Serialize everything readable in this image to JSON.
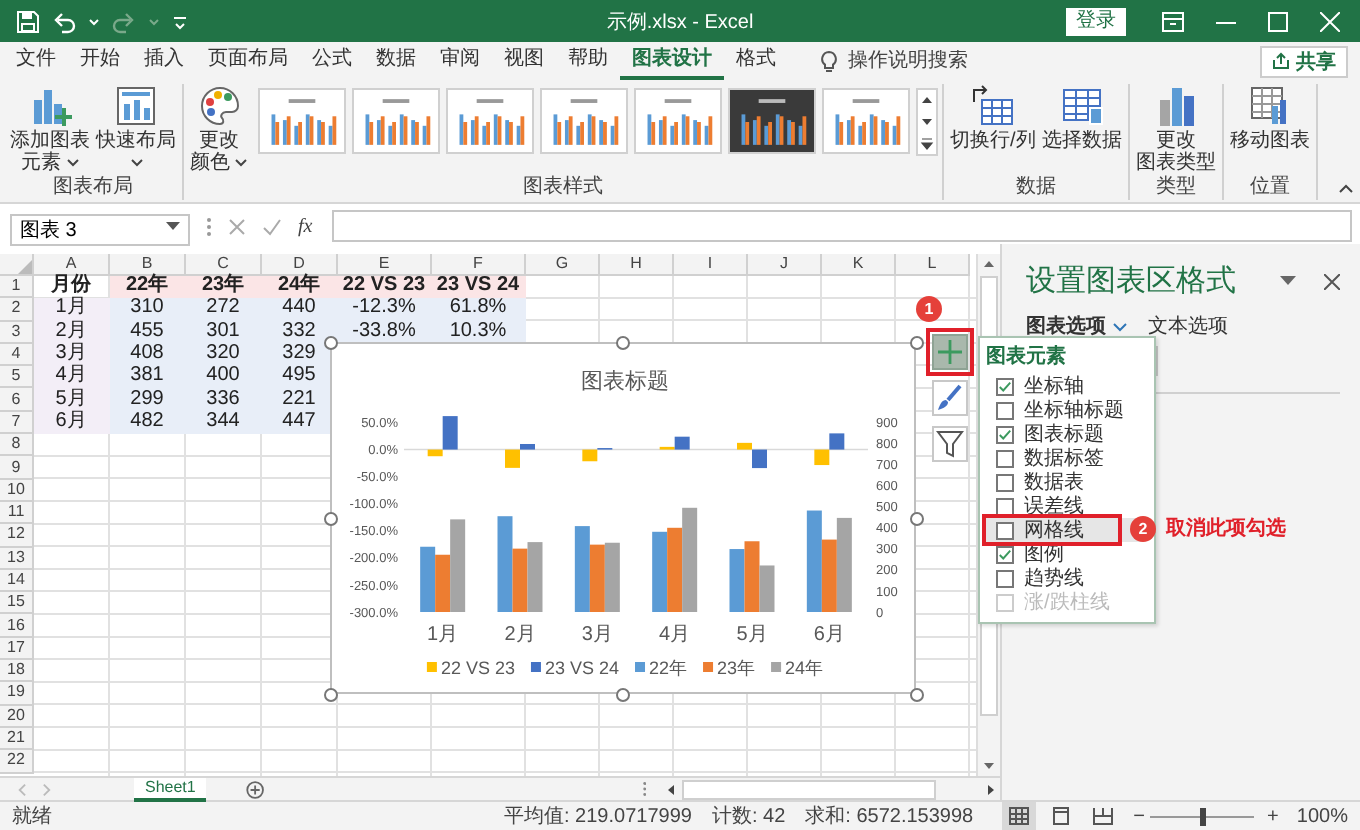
{
  "window": {
    "title": "示例.xlsx - Excel",
    "sign_in": "登录"
  },
  "tabs": [
    {
      "label": "文件",
      "selected": false
    },
    {
      "label": "开始",
      "selected": false
    },
    {
      "label": "插入",
      "selected": false
    },
    {
      "label": "页面布局",
      "selected": false
    },
    {
      "label": "公式",
      "selected": false
    },
    {
      "label": "数据",
      "selected": false
    },
    {
      "label": "审阅",
      "selected": false
    },
    {
      "label": "视图",
      "selected": false
    },
    {
      "label": "帮助",
      "selected": false
    },
    {
      "label": "图表设计",
      "selected": true
    },
    {
      "label": "格式",
      "selected": false
    }
  ],
  "search": {
    "placeholder": "操作说明搜索"
  },
  "share_button": "共享",
  "ribbon": {
    "groups": [
      {
        "label": "图表布局",
        "buttons": [
          {
            "kind": "add-element",
            "lines": [
              "添加图表",
              "元素"
            ],
            "menu": true
          },
          {
            "kind": "quick-layout",
            "lines": [
              "快速布局"
            ],
            "menu": true
          }
        ]
      },
      {
        "label": "图表样式",
        "buttons": [
          {
            "kind": "colors",
            "lines": [
              "更改",
              "颜色"
            ],
            "menu": true
          }
        ],
        "styles": [
          {
            "kind": "light"
          },
          {
            "kind": "light"
          },
          {
            "kind": "light"
          },
          {
            "kind": "light"
          },
          {
            "kind": "light"
          },
          {
            "kind": "dark"
          },
          {
            "kind": "light"
          }
        ]
      },
      {
        "label": "数据",
        "buttons": [
          {
            "kind": "switch",
            "lines": [
              "切换行/列"
            ],
            "menu": false
          },
          {
            "kind": "select-data",
            "lines": [
              "选择数据"
            ],
            "menu": false
          }
        ]
      },
      {
        "label": "类型",
        "buttons": [
          {
            "kind": "chart-type",
            "lines": [
              "更改",
              "图表类型"
            ],
            "menu": false
          }
        ]
      },
      {
        "label": "位置",
        "buttons": [
          {
            "kind": "move-chart",
            "lines": [
              "移动图表"
            ],
            "menu": false
          }
        ]
      }
    ]
  },
  "formula_bar": {
    "name_box": "图表 3",
    "function_label": "fx"
  },
  "sheet": {
    "columns": [
      "A",
      "B",
      "C",
      "D",
      "E",
      "F",
      "G",
      "H",
      "I",
      "J",
      "K",
      "L"
    ],
    "row_numbers": [
      "1",
      "2",
      "3",
      "4",
      "5",
      "6",
      "7",
      "8",
      "9",
      "10",
      "11",
      "12",
      "13",
      "14",
      "15",
      "16",
      "17",
      "18",
      "19",
      "20",
      "21",
      "22"
    ],
    "rows": [
      {
        "kind": "header",
        "cells": [
          "月份",
          "22年",
          "23年",
          "24年",
          "22 VS 23",
          "23 VS 24"
        ]
      },
      {
        "kind": "data",
        "cells": [
          "1月",
          "310",
          "272",
          "440",
          "-12.3%",
          "61.8%"
        ]
      },
      {
        "kind": "data",
        "cells": [
          "2月",
          "455",
          "301",
          "332",
          "-33.8%",
          "10.3%"
        ]
      },
      {
        "kind": "data",
        "cells": [
          "3月",
          "408",
          "320",
          "329"
        ]
      },
      {
        "kind": "data",
        "cells": [
          "4月",
          "381",
          "400",
          "495"
        ]
      },
      {
        "kind": "data",
        "cells": [
          "5月",
          "299",
          "336",
          "221"
        ]
      },
      {
        "kind": "data",
        "cells": [
          "6月",
          "482",
          "344",
          "447"
        ]
      }
    ]
  },
  "chart": {
    "side_buttons": [
      {
        "kind": "elements",
        "selected": true,
        "annotation": "1"
      },
      {
        "kind": "styles",
        "selected": false
      },
      {
        "kind": "filter",
        "selected": false
      }
    ],
    "chart_data": {
      "type": "bar",
      "title": "图表标题",
      "categories": [
        "1月",
        "2月",
        "3月",
        "4月",
        "5月",
        "6月"
      ],
      "series": [
        {
          "name": "22 VS 23",
          "color": "#ffc000",
          "values": [
            -12.3,
            -33.8,
            -21.6,
            5.0,
            12.4,
            -28.6
          ]
        },
        {
          "name": "23 VS 24",
          "color": "#4472c4",
          "values": [
            61.8,
            10.3,
            2.8,
            23.8,
            -34.2,
            29.9
          ]
        },
        {
          "name": "22年",
          "color": "#5b9bd5",
          "axis": "y2",
          "values": [
            310,
            455,
            408,
            381,
            299,
            482
          ]
        },
        {
          "name": "23年",
          "color": "#ed7d31",
          "axis": "y2",
          "values": [
            272,
            301,
            320,
            400,
            336,
            344
          ]
        },
        {
          "name": "24年",
          "color": "#a5a5a5",
          "axis": "y2",
          "values": [
            440,
            332,
            329,
            495,
            221,
            447
          ]
        }
      ],
      "stacked": false,
      "legend": "bottom",
      "ylim": [
        -300,
        62
      ],
      "yticks": [
        {
          "value": 50,
          "label": "50.0%"
        },
        {
          "value": 0,
          "label": "0.0%"
        },
        {
          "value": -50,
          "label": "-50.0%"
        },
        {
          "value": -100,
          "label": "-100.0%"
        },
        {
          "value": -150,
          "label": "-150.0%"
        },
        {
          "value": -200,
          "label": "-200.0%"
        },
        {
          "value": -250,
          "label": "-250.0%"
        },
        {
          "value": -300,
          "label": "-300.0%"
        }
      ],
      "y2lim": [
        0,
        931
      ],
      "y2ticks": [
        0,
        100,
        200,
        300,
        400,
        500,
        600,
        700,
        800,
        900
      ]
    }
  },
  "chart_elements": {
    "title": "图表元素",
    "items": [
      {
        "label": "坐标轴",
        "checked": true,
        "disabled": false,
        "highlighted": false
      },
      {
        "label": "坐标轴标题",
        "checked": false,
        "disabled": false,
        "highlighted": false
      },
      {
        "label": "图表标题",
        "checked": true,
        "disabled": false,
        "highlighted": false
      },
      {
        "label": "数据标签",
        "checked": false,
        "disabled": false,
        "highlighted": false
      },
      {
        "label": "数据表",
        "checked": false,
        "disabled": false,
        "highlighted": false
      },
      {
        "label": "误差线",
        "checked": false,
        "disabled": false,
        "highlighted": false
      },
      {
        "label": "网格线",
        "checked": false,
        "disabled": false,
        "highlighted": true,
        "annotation": "2",
        "note": "取消此项勾选"
      },
      {
        "label": "图例",
        "checked": true,
        "disabled": false,
        "highlighted": false
      },
      {
        "label": "趋势线",
        "checked": false,
        "disabled": false,
        "highlighted": false
      },
      {
        "label": "涨/跌柱线",
        "checked": false,
        "disabled": true,
        "highlighted": false
      }
    ]
  },
  "format_pane": {
    "title": "设置图表区格式",
    "tabs": [
      {
        "label": "图表选项",
        "selected": true
      },
      {
        "label": "文本选项",
        "selected": false
      }
    ]
  },
  "sheets": [
    {
      "label": "Sheet1",
      "selected": true
    }
  ],
  "status_bar": {
    "mode": "就绪",
    "average": "平均值: 219.0717999",
    "count": "计数: 42",
    "sum": "求和: 6572.153998",
    "views": [
      {
        "kind": "normal",
        "selected": true
      },
      {
        "kind": "page-layout",
        "selected": false
      },
      {
        "kind": "page-break",
        "selected": false
      }
    ],
    "zoom_out": "−",
    "zoom_in": "+",
    "zoom": {
      "level": 0.5
    },
    "zoom_label": "100%"
  }
}
